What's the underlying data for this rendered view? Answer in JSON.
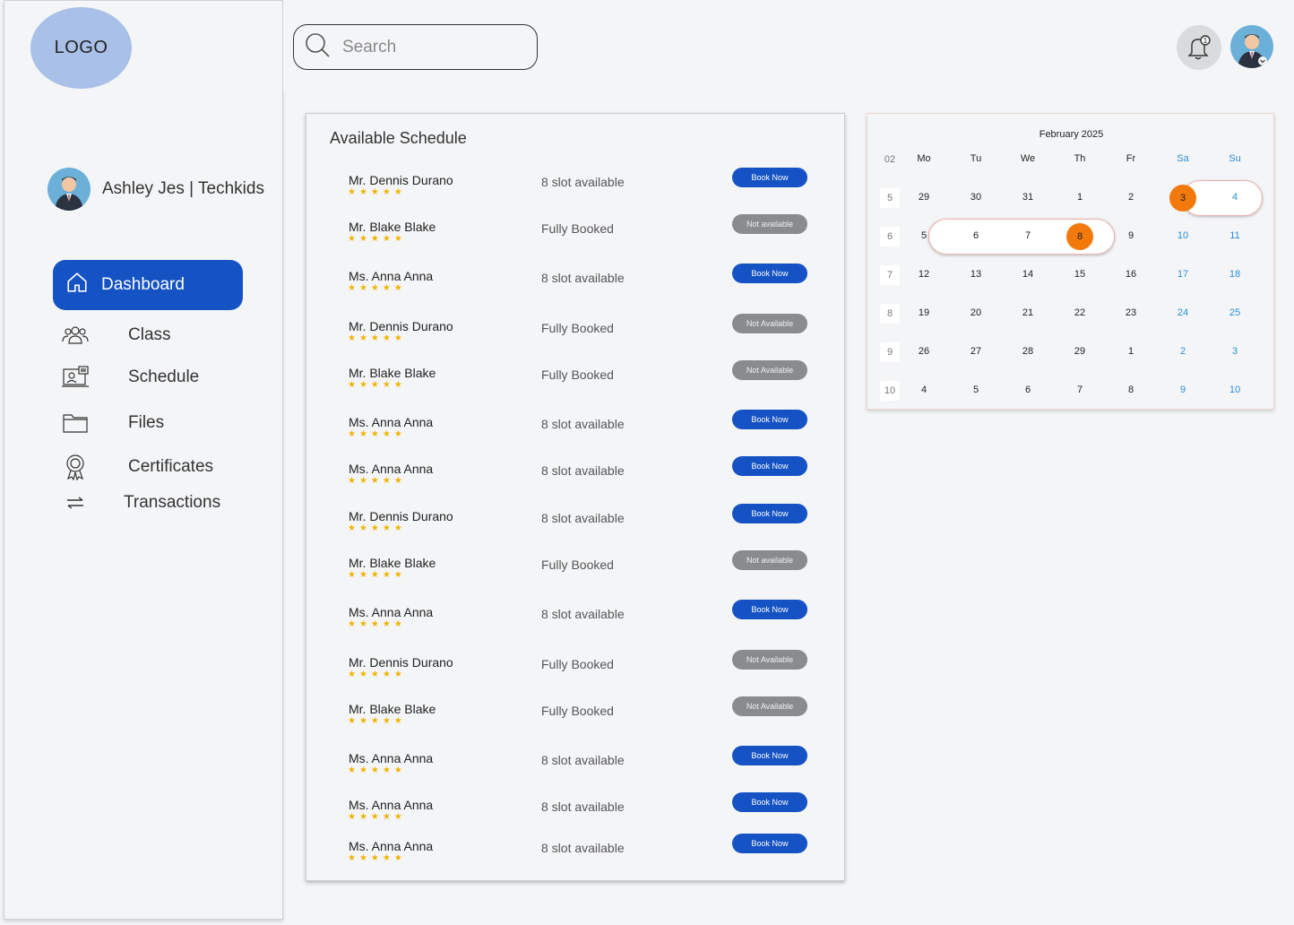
{
  "logo": "LOGO",
  "profile": {
    "name": "Ashley Jes | Techkids"
  },
  "search": {
    "placeholder": "Search"
  },
  "notifications": {
    "count": "1"
  },
  "nav": {
    "dashboard": "Dashboard",
    "class": "Class",
    "schedule": "Schedule",
    "files": "Files",
    "certificates": "Certificates",
    "transactions": "Transactions"
  },
  "schedule": {
    "title": "Available Schedule",
    "stars": "★★★★★",
    "rows": [
      {
        "name": "Mr. Dennis Durano",
        "status": "8 slot available",
        "button": "Book Now",
        "available": true
      },
      {
        "name": "Mr. Blake Blake",
        "status": "Fully Booked",
        "button": "Not available",
        "available": false
      },
      {
        "name": "Ms. Anna Anna",
        "status": "8 slot available",
        "button": "Book Now",
        "available": true
      },
      {
        "name": "Mr. Dennis Durano",
        "status": "Fully Booked",
        "button": "Not Available",
        "available": false
      },
      {
        "name": "Mr. Blake Blake",
        "status": "Fully Booked",
        "button": "Not Available",
        "available": false
      },
      {
        "name": "Ms. Anna Anna",
        "status": "8 slot available",
        "button": "Book Now",
        "available": true
      },
      {
        "name": "Ms. Anna Anna",
        "status": "8 slot available",
        "button": "Book Now",
        "available": true
      },
      {
        "name": "Mr. Dennis Durano",
        "status": "8 slot available",
        "button": "Book Now",
        "available": true
      },
      {
        "name": "Mr. Blake Blake",
        "status": "Fully Booked",
        "button": "Not available",
        "available": false
      },
      {
        "name": "Ms. Anna Anna",
        "status": "8 slot available",
        "button": "Book Now",
        "available": true
      },
      {
        "name": "Mr. Dennis Durano",
        "status": "Fully Booked",
        "button": "Not Available",
        "available": false
      },
      {
        "name": "Mr. Blake Blake",
        "status": "Fully Booked",
        "button": "Not Available",
        "available": false
      },
      {
        "name": "Ms. Anna Anna",
        "status": "8 slot available",
        "button": "Book Now",
        "available": true
      },
      {
        "name": "Ms. Anna Anna",
        "status": "8 slot available",
        "button": "Book Now",
        "available": true
      },
      {
        "name": "Ms. Anna Anna",
        "status": "8 slot available",
        "button": "Book Now",
        "available": true
      }
    ]
  },
  "calendar": {
    "title": "February 2025",
    "week_header": "02",
    "days": [
      "Mo",
      "Tu",
      "We",
      "Th",
      "Fr",
      "Sa",
      "Su"
    ],
    "weeks": [
      {
        "week": "5",
        "dates": [
          "29",
          "30",
          "31",
          "1",
          "2",
          "3",
          "4"
        ]
      },
      {
        "week": "6",
        "dates": [
          "5",
          "6",
          "7",
          "8",
          "9",
          "10",
          "11"
        ]
      },
      {
        "week": "7",
        "dates": [
          "12",
          "13",
          "14",
          "15",
          "16",
          "17",
          "18"
        ]
      },
      {
        "week": "8",
        "dates": [
          "19",
          "20",
          "21",
          "22",
          "23",
          "24",
          "25"
        ]
      },
      {
        "week": "9",
        "dates": [
          "26",
          "27",
          "28",
          "29",
          "1",
          "2",
          "3"
        ]
      },
      {
        "week": "10",
        "dates": [
          "4",
          "5",
          "6",
          "7",
          "8",
          "9",
          "10"
        ]
      }
    ],
    "highlight_color": "#f27a0d",
    "weekend_color": "#2a8fd6"
  },
  "colors": {
    "primary": "#1552c4",
    "disabled": "#8a8b8d",
    "star": "#f0b400"
  }
}
